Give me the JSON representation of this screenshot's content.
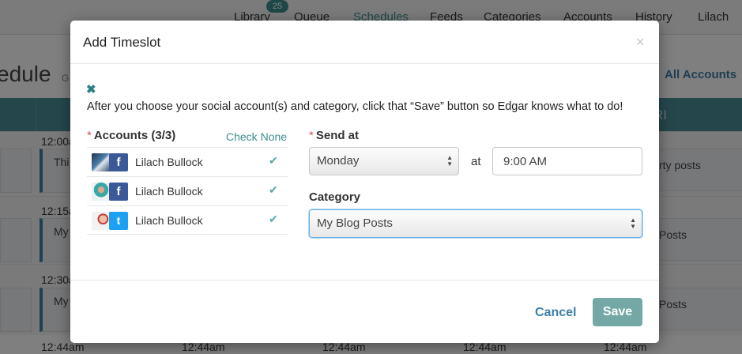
{
  "nav": {
    "badge": "25",
    "items": [
      "Library",
      "Queue",
      "Schedules",
      "Feeds",
      "Categories",
      "Accounts",
      "History",
      "Lilach"
    ]
  },
  "page": {
    "title": "edule",
    "title_suffix": "G",
    "all_accounts": "All Accounts",
    "fri": "RI",
    "times": [
      "12:00a",
      "12:15a",
      "12:30a"
    ],
    "post_snippets": [
      "Thi",
      "My",
      "My"
    ],
    "right_posts": [
      "rty posts",
      "Posts",
      "Posts"
    ],
    "bottom_times": [
      "12:44am",
      "12:44am",
      "12:44am",
      "12:44am",
      "12:44am"
    ]
  },
  "modal": {
    "title": "Add Timeslot",
    "close_glyph": "×",
    "dismiss_glyph": "✖",
    "instructions": "After you choose your social account(s) and category, click that “Save” button so Edgar knows what to do!",
    "accounts_label": "Accounts (3/3)",
    "required_mark": "*",
    "check_none": "Check None",
    "accounts": [
      {
        "name": "Lilach Bullock",
        "network": "f"
      },
      {
        "name": "Lilach Bullock",
        "network": "f"
      },
      {
        "name": "Lilach Bullock",
        "network": "t"
      }
    ],
    "check_glyph": "✔",
    "send_at_label": "Send at",
    "day": "Monday",
    "at": "at",
    "time_value": "9:00 AM",
    "category_label": "Category",
    "category": "My Blog Posts",
    "cancel": "Cancel",
    "save": "Save"
  },
  "colors": {
    "teal": "#4a8f98",
    "save_button": "#74a8a6",
    "link_blue": "#3e7fa6",
    "facebook": "#3b5998",
    "twitter": "#1da1f2"
  }
}
